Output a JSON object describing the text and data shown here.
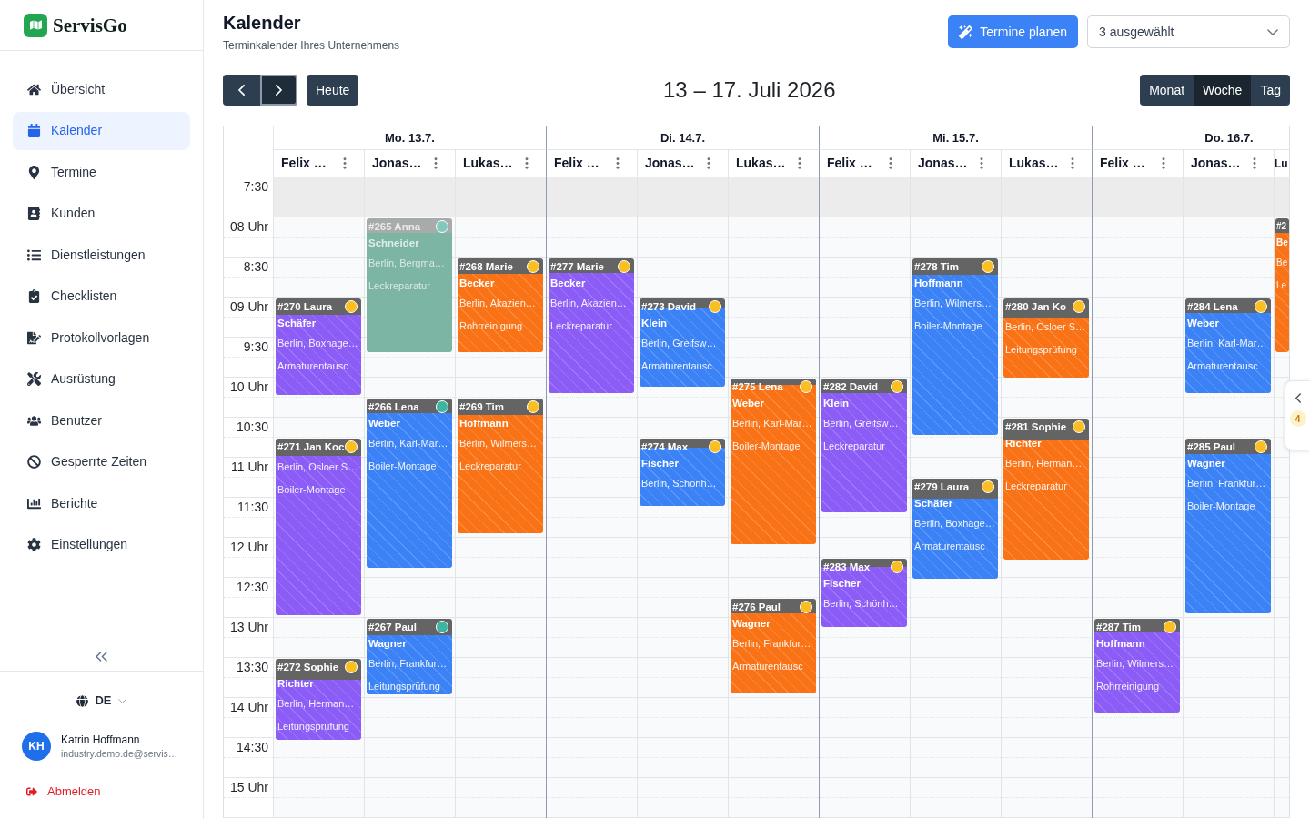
{
  "brand": "ServisGo",
  "sidebar": {
    "items": [
      {
        "label": "Übersicht",
        "selected": false
      },
      {
        "label": "Kalender",
        "selected": true
      },
      {
        "label": "Termine",
        "selected": false
      },
      {
        "label": "Kunden",
        "selected": false
      },
      {
        "label": "Dienstleistungen",
        "selected": false
      },
      {
        "label": "Checklisten",
        "selected": false
      },
      {
        "label": "Protokollvorlagen",
        "selected": false
      },
      {
        "label": "Ausrüstung",
        "selected": false
      },
      {
        "label": "Benutzer",
        "selected": false
      },
      {
        "label": "Gesperrte Zeiten",
        "selected": false
      },
      {
        "label": "Berichte",
        "selected": false
      },
      {
        "label": "Einstellungen",
        "selected": false
      }
    ],
    "language": "DE",
    "user": {
      "initials": "KH",
      "name": "Katrin Hoffmann",
      "email": "industry.demo.de@servis…"
    },
    "logout": "Abmelden"
  },
  "header": {
    "title": "Kalender",
    "subtitle": "Terminkalender Ihres Unternehmens",
    "plan_button": "Termine planen",
    "staff_select": "3 ausgewählt"
  },
  "toolbar": {
    "pager": [
      {
        "focused": false
      },
      {
        "focused": true
      }
    ],
    "today_button": "Heute",
    "range": "13 – 17. Juli 2026",
    "views": [
      {
        "label": "Monat",
        "selected": false
      },
      {
        "label": "Woche",
        "selected": true
      },
      {
        "label": "Tag",
        "selected": false
      }
    ]
  },
  "calendar": {
    "time_labels": [
      "7:30",
      "08 Uhr",
      "8:30",
      "09 Uhr",
      "9:30",
      "10 Uhr",
      "10:30",
      "11 Uhr",
      "11:30",
      "12 Uhr",
      "12:30",
      "13 Uhr",
      "13:30",
      "14 Uhr",
      "14:30",
      "15 Uhr"
    ],
    "days": [
      {
        "label": "Mo. 13.7.",
        "resources": [
          {
            "name": "Felix …",
            "events": [
              {
                "title": "#270 Laura",
                "name": "Schäfer",
                "address": "Berlin, Boxhage…",
                "service": "Armaturentausc",
                "color": "#8b5cf6",
                "dot": {
                  "color": "#fbbf24"
                },
                "dimmed": false
              },
              {
                "title": "#271 Jan Koc",
                "address": "Berlin, Osloer S…",
                "service": "Boiler-Montage",
                "color": "#8b5cf6",
                "dot": {
                  "color": "#fbbf24"
                },
                "dimmed": false
              },
              {
                "title": "#272 Sophie",
                "name": "Richter",
                "address": "Berlin, Herman…",
                "service": "Leitungsprüfung",
                "color": "#8b5cf6",
                "dot": {
                  "color": "#fbbf24"
                },
                "dimmed": false
              }
            ]
          },
          {
            "name": "Jonas…",
            "events": [
              {
                "title": "#265 Anna",
                "name": "Schneider",
                "address": "Berlin, Bergma…",
                "service": "Leckreparatur",
                "color": "#7db5a5",
                "dot": {
                  "color": "#80c9bc"
                },
                "dimmed": true
              },
              {
                "title": "#266 Lena",
                "name": "Weber",
                "address": "Berlin, Karl-Mar…",
                "service": "Boiler-Montage",
                "color": "#3b82f6",
                "dot": {
                  "color": "#3db5a0"
                },
                "dimmed": false
              },
              {
                "title": "#267 Paul",
                "name": "Wagner",
                "address": "Berlin, Frankfur…",
                "service": "Leitungsprüfung",
                "color": "#3b82f6",
                "dot": {
                  "color": "#3db5a0"
                },
                "dimmed": false
              }
            ]
          },
          {
            "name": "Lukas…",
            "events": [
              {
                "title": "#268 Marie",
                "name": "Becker",
                "address": "Berlin, Akazien…",
                "service": "Rohrreinigung",
                "color": "#f97316",
                "dot": {
                  "color": "#fbbf24"
                },
                "dimmed": false
              },
              {
                "title": "#269 Tim",
                "name": "Hoffmann",
                "address": "Berlin, Wilmers…",
                "service": "Leckreparatur",
                "color": "#f97316",
                "dot": {
                  "color": "#fbbf24"
                },
                "dimmed": false
              }
            ]
          }
        ]
      },
      {
        "label": "Di. 14.7.",
        "resources": [
          {
            "name": "Felix …",
            "events": [
              {
                "title": "#277 Marie",
                "name": "Becker",
                "address": "Berlin, Akazien…",
                "service": "Leckreparatur",
                "color": "#8b5cf6",
                "dot": {
                  "color": "#fbbf24"
                },
                "dimmed": false
              }
            ]
          },
          {
            "name": "Jonas…",
            "events": [
              {
                "title": "#273 David",
                "name": "Klein",
                "address": "Berlin, Greifsw…",
                "service": "Armaturentausc",
                "color": "#3b82f6",
                "dot": {
                  "color": "#fbbf24"
                },
                "dimmed": false
              },
              {
                "title": "#274 Max",
                "name": "Fischer",
                "address": "Berlin, Schönh…",
                "color": "#3b82f6",
                "dot": {
                  "color": "#fbbf24"
                },
                "dimmed": false
              }
            ]
          },
          {
            "name": "Lukas…",
            "events": [
              {
                "title": "#275 Lena",
                "name": "Weber",
                "address": "Berlin, Karl-Mar…",
                "service": "Boiler-Montage",
                "color": "#f97316",
                "dot": {
                  "color": "#fbbf24"
                },
                "dimmed": false
              },
              {
                "title": "#276 Paul",
                "name": "Wagner",
                "address": "Berlin, Frankfur…",
                "service": "Armaturentausc",
                "color": "#f97316",
                "dot": {
                  "color": "#fbbf24"
                },
                "dimmed": false
              }
            ]
          }
        ]
      },
      {
        "label": "Mi. 15.7.",
        "resources": [
          {
            "name": "Felix …",
            "events": [
              {
                "title": "#282 David",
                "name": "Klein",
                "address": "Berlin, Greifsw…",
                "service": "Leckreparatur",
                "color": "#8b5cf6",
                "dot": {
                  "color": "#fbbf24"
                },
                "dimmed": false
              },
              {
                "title": "#283 Max",
                "name": "Fischer",
                "address": "Berlin, Schönh…",
                "color": "#8b5cf6",
                "dot": {
                  "color": "#fbbf24"
                },
                "dimmed": false
              }
            ]
          },
          {
            "name": "Jonas…",
            "events": [
              {
                "title": "#278 Tim",
                "name": "Hoffmann",
                "address": "Berlin, Wilmers…",
                "service": "Boiler-Montage",
                "color": "#3b82f6",
                "dot": {
                  "color": "#fbbf24"
                },
                "dimmed": false
              },
              {
                "title": "#279 Laura",
                "name": "Schäfer",
                "address": "Berlin, Boxhage…",
                "service": "Armaturentausc",
                "color": "#3b82f6",
                "dot": {
                  "color": "#fbbf24"
                },
                "dimmed": false
              }
            ]
          },
          {
            "name": "Lukas…",
            "events": [
              {
                "title": "#280 Jan Ko",
                "address": "Berlin, Osloer S…",
                "service": "Leitungsprüfung",
                "color": "#f97316",
                "dot": {
                  "color": "#fbbf24"
                },
                "dimmed": false
              },
              {
                "title": "#281 Sophie",
                "name": "Richter",
                "address": "Berlin, Herman…",
                "service": "Leckreparatur",
                "color": "#f97316",
                "dot": {
                  "color": "#fbbf24"
                },
                "dimmed": false
              }
            ]
          }
        ]
      },
      {
        "label": "Do. 16.7.",
        "resources": [
          {
            "name": "Felix …",
            "events": [
              {
                "title": "#287 Tim",
                "name": "Hoffmann",
                "address": "Berlin, Wilmers…",
                "service": "Rohrreinigung",
                "color": "#8b5cf6",
                "dot": {
                  "color": "#fbbf24"
                },
                "dimmed": false
              }
            ]
          },
          {
            "name": "Jonas…",
            "events": [
              {
                "title": "#284 Lena",
                "name": "Weber",
                "address": "Berlin, Karl-Mar…",
                "service": "Armaturentausc",
                "color": "#3b82f6",
                "dot": {
                  "color": "#fbbf24"
                },
                "dimmed": false
              },
              {
                "title": "#285 Paul",
                "name": "Wagner",
                "address": "Berlin, Frankfur…",
                "service": "Boiler-Montage",
                "color": "#3b82f6",
                "dot": {
                  "color": "#fbbf24"
                },
                "dimmed": false
              }
            ]
          },
          {
            "name": "Lu",
            "events": [
              {
                "title": "#2",
                "name": "Be",
                "address": "Be",
                "service": "Le",
                "color": "#f97316",
                "dimmed": false
              }
            ]
          }
        ]
      }
    ]
  },
  "side_panel": {
    "badge": "4"
  }
}
